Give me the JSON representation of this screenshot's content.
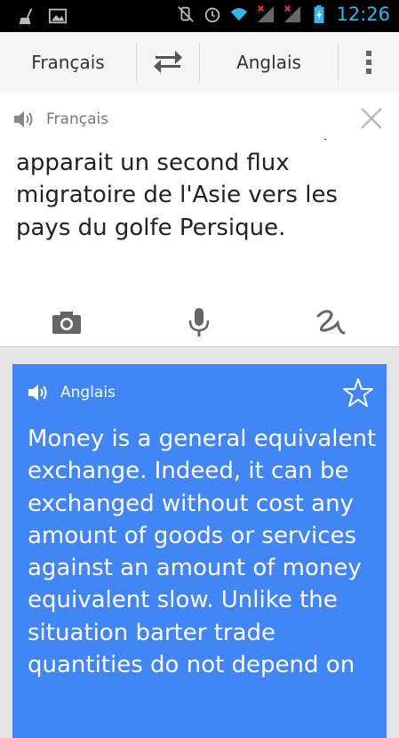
{
  "status_bar": {
    "time": "12:26",
    "icons": [
      "broom-icon",
      "image-icon",
      "mute-icon",
      "alarm-icon",
      "wifi-icon",
      "signal-icon",
      "signal-icon",
      "battery-charging-icon"
    ]
  },
  "toolbar": {
    "source_language": "Français",
    "target_language": "Anglais",
    "swap_icon": "swap-arrows-icon",
    "menu_icon": "overflow-menu-icon"
  },
  "input": {
    "language": "Français",
    "text": "occidentale. Parallèlement,  il apparait un second flux migratoire de l'Asie vers les pays du golfe Persique.",
    "actions": [
      "camera-icon",
      "microphone-icon",
      "handwriting-icon"
    ]
  },
  "output": {
    "language": "Anglais",
    "text": "Money is a general equivalent exchange. Indeed, it can be exchanged without cost any amount of goods or services against an amount of money equivalent slow. Unlike the situation barter trade quantities do not depend on"
  },
  "colors": {
    "status_bar_bg": "#000000",
    "clock": "#33b5e5",
    "accent_blue": "#4285f4",
    "toolbar_bg": "#f5f5f5",
    "card_bg": "#ffffff"
  }
}
